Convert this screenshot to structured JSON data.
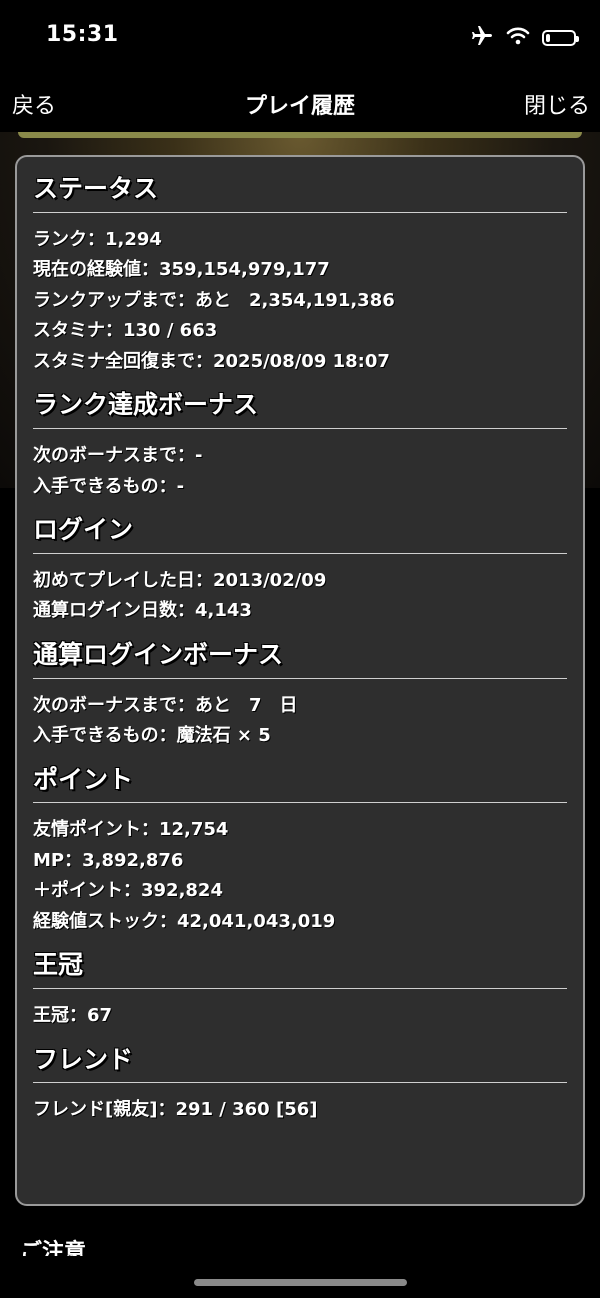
{
  "status_bar": {
    "time": "15:31",
    "icons": [
      "airplane-icon",
      "wifi-icon",
      "battery-icon"
    ],
    "battery_level_percent": 15
  },
  "nav": {
    "back_label": "戻る",
    "title": "プレイ履歴",
    "close_label": "閉じる"
  },
  "sections": {
    "status": {
      "title": "ステータス",
      "rows": [
        "ランク：1,294",
        "現在の経験値：359,154,979,177",
        "ランクアップまで：あと　2,354,191,386",
        "スタミナ：130 / 663",
        "スタミナ全回復まで：2025/08/09 18:07"
      ]
    },
    "rank_bonus": {
      "title": "ランク達成ボーナス",
      "rows": [
        "次のボーナスまで：-",
        "入手できるもの：-"
      ]
    },
    "login": {
      "title": "ログイン",
      "rows": [
        "初めてプレイした日：2013/02/09",
        "通算ログイン日数：4,143"
      ]
    },
    "login_bonus": {
      "title": "通算ログインボーナス",
      "rows": [
        "次のボーナスまで：あと　7　日",
        "入手できるもの：魔法石 × 5"
      ]
    },
    "points": {
      "title": "ポイント",
      "rows": [
        "友情ポイント：12,754",
        "MP：3,892,876",
        "＋ポイント：392,824",
        "経験値ストック：42,041,043,019"
      ]
    },
    "crown": {
      "title": "王冠",
      "rows": [
        "王冠：67"
      ]
    },
    "friend": {
      "title": "フレンド",
      "rows": [
        "フレンド[親友]：291 / 360 [56]"
      ]
    }
  },
  "footer": {
    "note_title": "ご注意"
  },
  "colors": {
    "background": "#000000",
    "panel": "#2e2e2e",
    "panel_border": "#9a9a9a",
    "text": "#ffffff"
  }
}
